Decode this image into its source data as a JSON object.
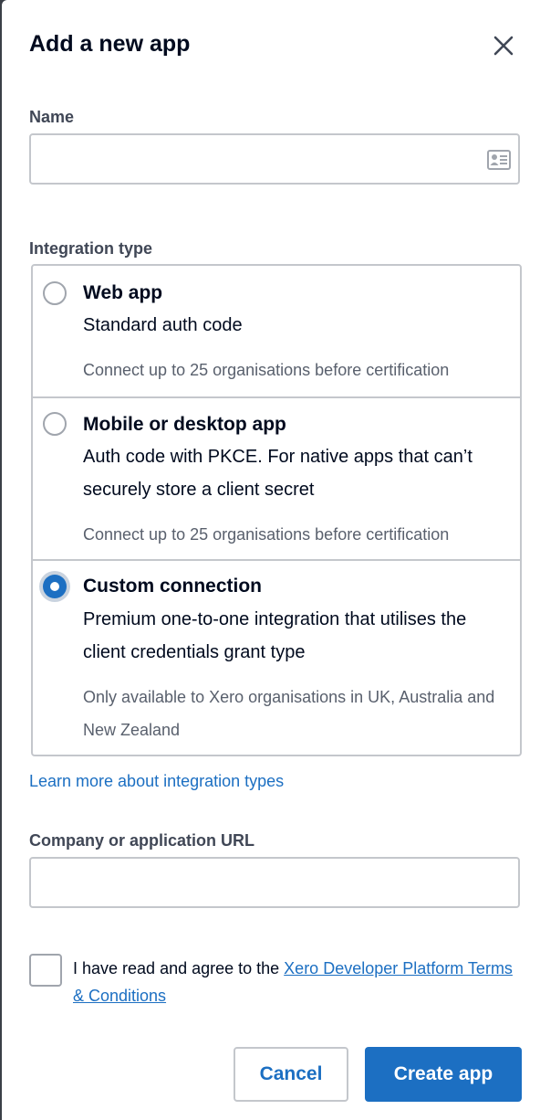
{
  "dialog": {
    "title": "Add a new app"
  },
  "name_field": {
    "label": "Name",
    "value": "",
    "placeholder": ""
  },
  "integration": {
    "label": "Integration type",
    "options": [
      {
        "title": "Web app",
        "description": "Standard auth code",
        "note": "Connect up to 25 organisations before certification",
        "selected": false
      },
      {
        "title": "Mobile or desktop app",
        "description": "Auth code with PKCE. For native apps that can’t securely store a client secret",
        "note": "Connect up to 25 organisations before certification",
        "selected": false
      },
      {
        "title": "Custom connection",
        "description": "Premium one-to-one integration that utilises the client credentials grant type",
        "note": "Only available to Xero organisations in UK, Australia and New Zealand",
        "selected": true
      }
    ],
    "learn_more_link": "Learn more about integration types"
  },
  "url_field": {
    "label": "Company or application URL",
    "value": "",
    "placeholder": ""
  },
  "terms": {
    "text": "I have read and agree to the ",
    "link": "Xero Developer Platform Terms & Conditions",
    "checked": false
  },
  "actions": {
    "cancel_label": "Cancel",
    "create_label": "Create app"
  },
  "colors": {
    "accent": "#1c6fc2",
    "border": "#c4c7cc",
    "text": "#000a1e",
    "muted": "#59606d"
  },
  "icons": {
    "close": "close-icon",
    "name_field": "contact-card-icon"
  }
}
